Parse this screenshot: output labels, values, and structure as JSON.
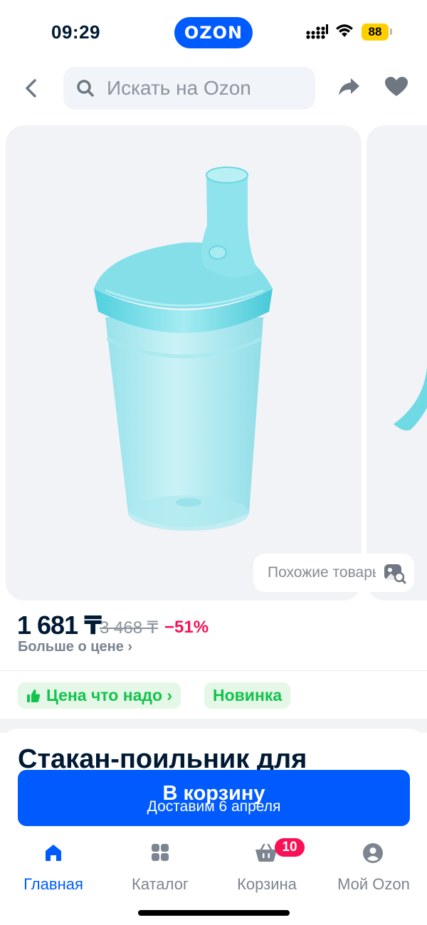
{
  "status_bar": {
    "time": "09:29",
    "app_pill": "OZON",
    "battery": "88",
    "icons": [
      "signal-icon",
      "wifi-icon",
      "battery-icon"
    ]
  },
  "header": {
    "search_placeholder": "Искать на Ozon",
    "icons": [
      "back-icon",
      "search-icon",
      "share-icon",
      "heart-icon"
    ]
  },
  "gallery": {
    "similar_label": "Похожие товары",
    "icons": [
      "similar-search-icon"
    ]
  },
  "price": {
    "current": "1 681 ₸",
    "old": "3 468 ₸",
    "discount": "−51%",
    "more_label": "Больше о цене ›"
  },
  "badges": {
    "price_badge": "Цена что надо ›",
    "new_badge": "Новинка",
    "icons": [
      "thumbs-up-icon"
    ]
  },
  "product": {
    "title": "Стакан-поильник для"
  },
  "cart_button": {
    "label": "В корзину",
    "delivery": "Доставим 6 апреля"
  },
  "tabbar": {
    "items": [
      {
        "label": "Главная",
        "icon": "home-icon",
        "active": true
      },
      {
        "label": "Каталог",
        "icon": "catalog-icon",
        "active": false
      },
      {
        "label": "Корзина",
        "icon": "cart-icon",
        "active": false
      },
      {
        "label": "Мой Ozon",
        "icon": "profile-icon",
        "active": false
      }
    ],
    "cart_count": "10"
  },
  "colors": {
    "brand": "#005bff",
    "discount": "#f91155",
    "badge_green": "#10c44c",
    "badge_bg": "#e5f7e7",
    "text_primary": "#001a34"
  }
}
